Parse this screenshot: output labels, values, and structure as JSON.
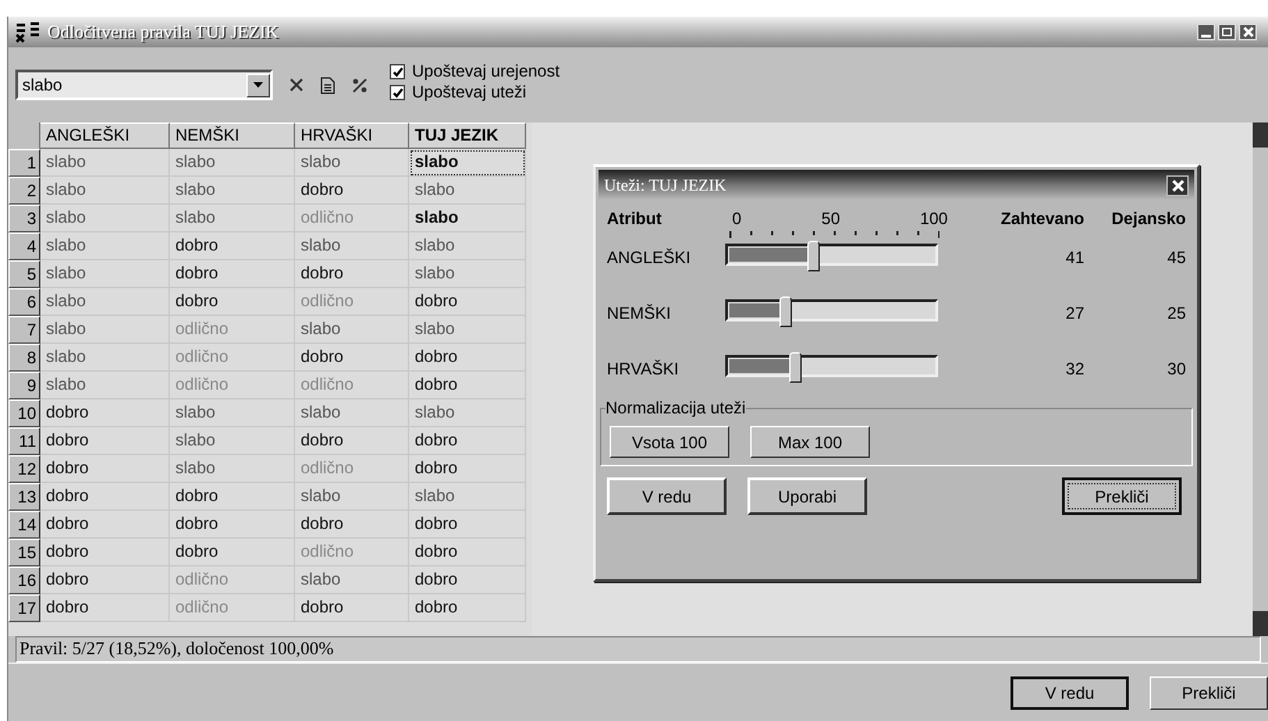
{
  "window": {
    "title": "Odločitvena pravila TUJ JEZIK"
  },
  "toolbar": {
    "filter": {
      "value": "slabo"
    },
    "checkboxes": [
      {
        "label": "Upoštevaj urejenost",
        "checked": true
      },
      {
        "label": "Upoštevaj uteži",
        "checked": true
      }
    ]
  },
  "table": {
    "columns": [
      {
        "label": "ANGLEŠKI",
        "bold": false
      },
      {
        "label": "NEMŠKI",
        "bold": false
      },
      {
        "label": "HRVAŠKI",
        "bold": false
      },
      {
        "label": "TUJ JEZIK",
        "bold": true
      }
    ],
    "rows": [
      {
        "number": "1",
        "cells": [
          {
            "text": "slabo",
            "color": "#555555"
          },
          {
            "text": "slabo",
            "color": "#555555"
          },
          {
            "text": "slabo",
            "color": "#555555"
          },
          {
            "text": "slabo",
            "color": "#111111",
            "bold": true,
            "focused": true
          }
        ]
      },
      {
        "number": "2",
        "cells": [
          {
            "text": "slabo",
            "color": "#555555"
          },
          {
            "text": "slabo",
            "color": "#555555"
          },
          {
            "text": "dobro",
            "color": "#111111"
          },
          {
            "text": "slabo",
            "color": "#555555"
          }
        ]
      },
      {
        "number": "3",
        "cells": [
          {
            "text": "slabo",
            "color": "#555555"
          },
          {
            "text": "slabo",
            "color": "#555555"
          },
          {
            "text": "odlično",
            "color": "#888888"
          },
          {
            "text": "slabo",
            "color": "#111111",
            "bold": true
          }
        ]
      },
      {
        "number": "4",
        "cells": [
          {
            "text": "slabo",
            "color": "#555555"
          },
          {
            "text": "dobro",
            "color": "#111111"
          },
          {
            "text": "slabo",
            "color": "#555555"
          },
          {
            "text": "slabo",
            "color": "#555555"
          }
        ]
      },
      {
        "number": "5",
        "cells": [
          {
            "text": "slabo",
            "color": "#555555"
          },
          {
            "text": "dobro",
            "color": "#111111"
          },
          {
            "text": "dobro",
            "color": "#111111"
          },
          {
            "text": "slabo",
            "color": "#555555"
          }
        ]
      },
      {
        "number": "6",
        "cells": [
          {
            "text": "slabo",
            "color": "#555555"
          },
          {
            "text": "dobro",
            "color": "#111111"
          },
          {
            "text": "odlično",
            "color": "#888888"
          },
          {
            "text": "dobro",
            "color": "#111111"
          }
        ]
      },
      {
        "number": "7",
        "cells": [
          {
            "text": "slabo",
            "color": "#555555"
          },
          {
            "text": "odlično",
            "color": "#888888"
          },
          {
            "text": "slabo",
            "color": "#555555"
          },
          {
            "text": "slabo",
            "color": "#555555"
          }
        ]
      },
      {
        "number": "8",
        "cells": [
          {
            "text": "slabo",
            "color": "#555555"
          },
          {
            "text": "odlično",
            "color": "#888888"
          },
          {
            "text": "dobro",
            "color": "#111111"
          },
          {
            "text": "dobro",
            "color": "#111111"
          }
        ]
      },
      {
        "number": "9",
        "cells": [
          {
            "text": "slabo",
            "color": "#555555"
          },
          {
            "text": "odlično",
            "color": "#888888"
          },
          {
            "text": "odlično",
            "color": "#888888"
          },
          {
            "text": "dobro",
            "color": "#111111"
          }
        ]
      },
      {
        "number": "10",
        "cells": [
          {
            "text": "dobro",
            "color": "#111111"
          },
          {
            "text": "slabo",
            "color": "#555555"
          },
          {
            "text": "slabo",
            "color": "#555555"
          },
          {
            "text": "slabo",
            "color": "#555555"
          }
        ]
      },
      {
        "number": "11",
        "cells": [
          {
            "text": "dobro",
            "color": "#111111"
          },
          {
            "text": "slabo",
            "color": "#555555"
          },
          {
            "text": "dobro",
            "color": "#111111"
          },
          {
            "text": "dobro",
            "color": "#111111"
          }
        ]
      },
      {
        "number": "12",
        "cells": [
          {
            "text": "dobro",
            "color": "#111111"
          },
          {
            "text": "slabo",
            "color": "#555555"
          },
          {
            "text": "odlično",
            "color": "#888888"
          },
          {
            "text": "dobro",
            "color": "#111111"
          }
        ]
      },
      {
        "number": "13",
        "cells": [
          {
            "text": "dobro",
            "color": "#111111"
          },
          {
            "text": "dobro",
            "color": "#111111"
          },
          {
            "text": "slabo",
            "color": "#555555"
          },
          {
            "text": "slabo",
            "color": "#555555"
          }
        ]
      },
      {
        "number": "14",
        "cells": [
          {
            "text": "dobro",
            "color": "#111111"
          },
          {
            "text": "dobro",
            "color": "#111111"
          },
          {
            "text": "dobro",
            "color": "#111111"
          },
          {
            "text": "dobro",
            "color": "#111111"
          }
        ]
      },
      {
        "number": "15",
        "cells": [
          {
            "text": "dobro",
            "color": "#111111"
          },
          {
            "text": "dobro",
            "color": "#111111"
          },
          {
            "text": "odlično",
            "color": "#888888"
          },
          {
            "text": "dobro",
            "color": "#111111"
          }
        ]
      },
      {
        "number": "16",
        "cells": [
          {
            "text": "dobro",
            "color": "#111111"
          },
          {
            "text": "odlično",
            "color": "#888888"
          },
          {
            "text": "slabo",
            "color": "#555555"
          },
          {
            "text": "dobro",
            "color": "#111111"
          }
        ]
      },
      {
        "number": "17",
        "cells": [
          {
            "text": "dobro",
            "color": "#111111"
          },
          {
            "text": "odlično",
            "color": "#888888"
          },
          {
            "text": "dobro",
            "color": "#111111"
          },
          {
            "text": "dobro",
            "color": "#111111"
          }
        ]
      }
    ]
  },
  "status_bar": "Pravil: 5/27 (18,52%), določenost 100,00%",
  "dialog": {
    "title": "Uteži: TUJ JEZIK",
    "headers": {
      "attribute": "Atribut",
      "scale": [
        "0",
        "50",
        "100"
      ],
      "required": "Zahtevano",
      "actual": "Dejansko"
    },
    "rows": [
      {
        "name": "ANGLEŠKI",
        "level": 0.41,
        "required": "41",
        "actual": "45"
      },
      {
        "name": "NEMŠKI",
        "level": 0.27,
        "required": "27",
        "actual": "25"
      },
      {
        "name": "HRVAŠKI",
        "level": 0.32,
        "required": "32",
        "actual": "30"
      }
    ],
    "normalization": {
      "label": "Normalizacija uteži",
      "buttons": [
        "Vsota 100",
        "Max 100"
      ]
    },
    "buttons": [
      {
        "label": "V redu",
        "default": false
      },
      {
        "label": "Uporabi",
        "default": false
      },
      {
        "label": "Prekliči",
        "default": true
      }
    ]
  },
  "buttons": [
    {
      "label": "V redu",
      "default": true
    },
    {
      "label": "Prekliči",
      "default": false
    }
  ]
}
